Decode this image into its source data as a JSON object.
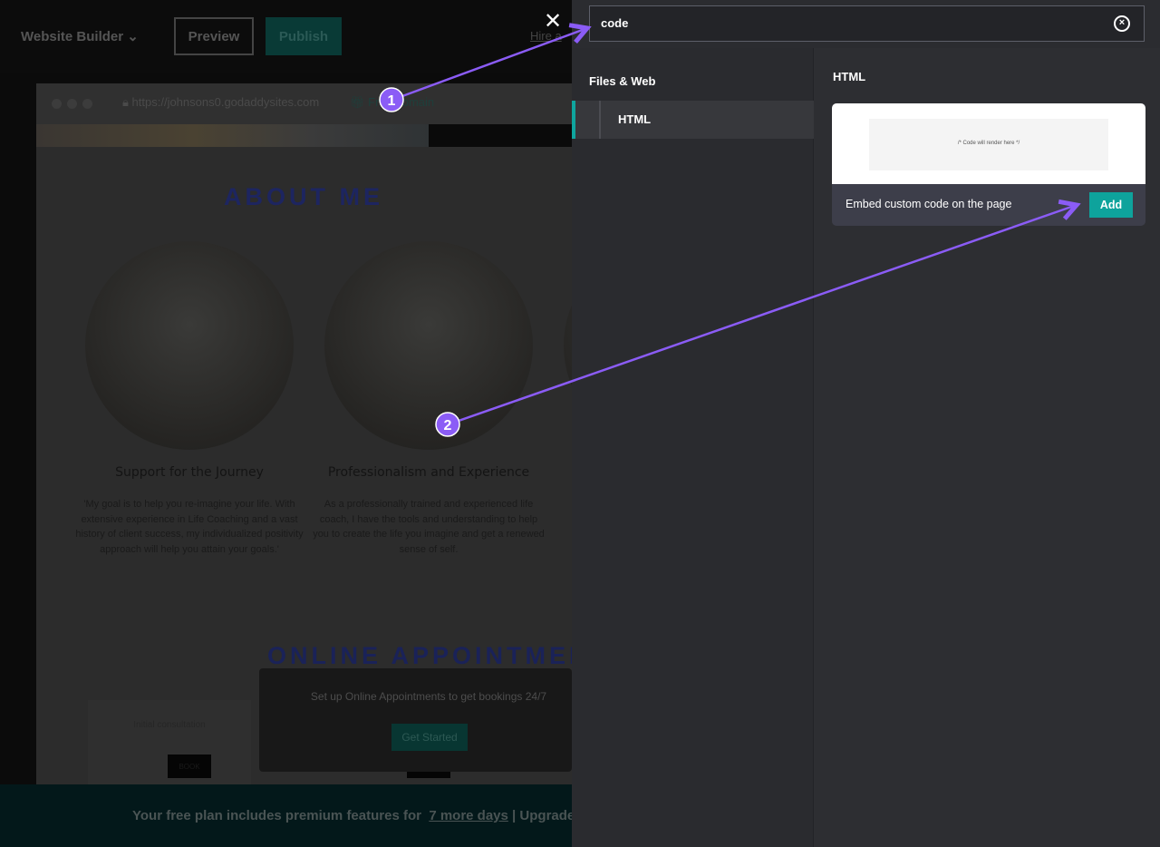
{
  "editor": {
    "app_menu": "Website Builder",
    "preview_label": "Preview",
    "publish_label": "Publish",
    "hire_link": "Hire a",
    "close_icon": "close-icon"
  },
  "site_preview": {
    "url": "https://johnsons0.godaddysites.com",
    "domain_label": "Free domain",
    "about_heading": "ABOUT ME",
    "columns": [
      {
        "title": "Support for the Journey",
        "text": "'My goal is to help you re-imagine your life. With extensive experience in Life Coaching and a vast history of client success, my individualized positivity approach will help you attain your goals.'"
      },
      {
        "title": "Professionalism and Experience",
        "text": "As a professionally trained and experienced life coach, I have the tools and understanding to help you to create the life you imagine and get a renewed sense of self."
      }
    ],
    "appointments_heading": "ONLINE APPOINTMENTS",
    "card_title": "Initial consultation",
    "book_label": "BOOK",
    "popup_text": "Set up Online Appointments to get bookings 24/7",
    "get_started_label": "Get Started"
  },
  "banner": {
    "text": "Your free plan includes premium features for",
    "link": "7 more days",
    "separator": "|",
    "upgrade": "Upgrade a"
  },
  "panel": {
    "search_value": "code",
    "category": "Files & Web",
    "items": [
      {
        "label": "HTML"
      }
    ],
    "section_title": "HTML",
    "widget": {
      "code_placeholder": "/* Code will render here */",
      "description": "Embed custom code on the page",
      "add_label": "Add"
    },
    "accent": "#0ea39c"
  },
  "annotations": [
    {
      "number": "1"
    },
    {
      "number": "2"
    }
  ],
  "annotation_color": "#8b5cf6"
}
